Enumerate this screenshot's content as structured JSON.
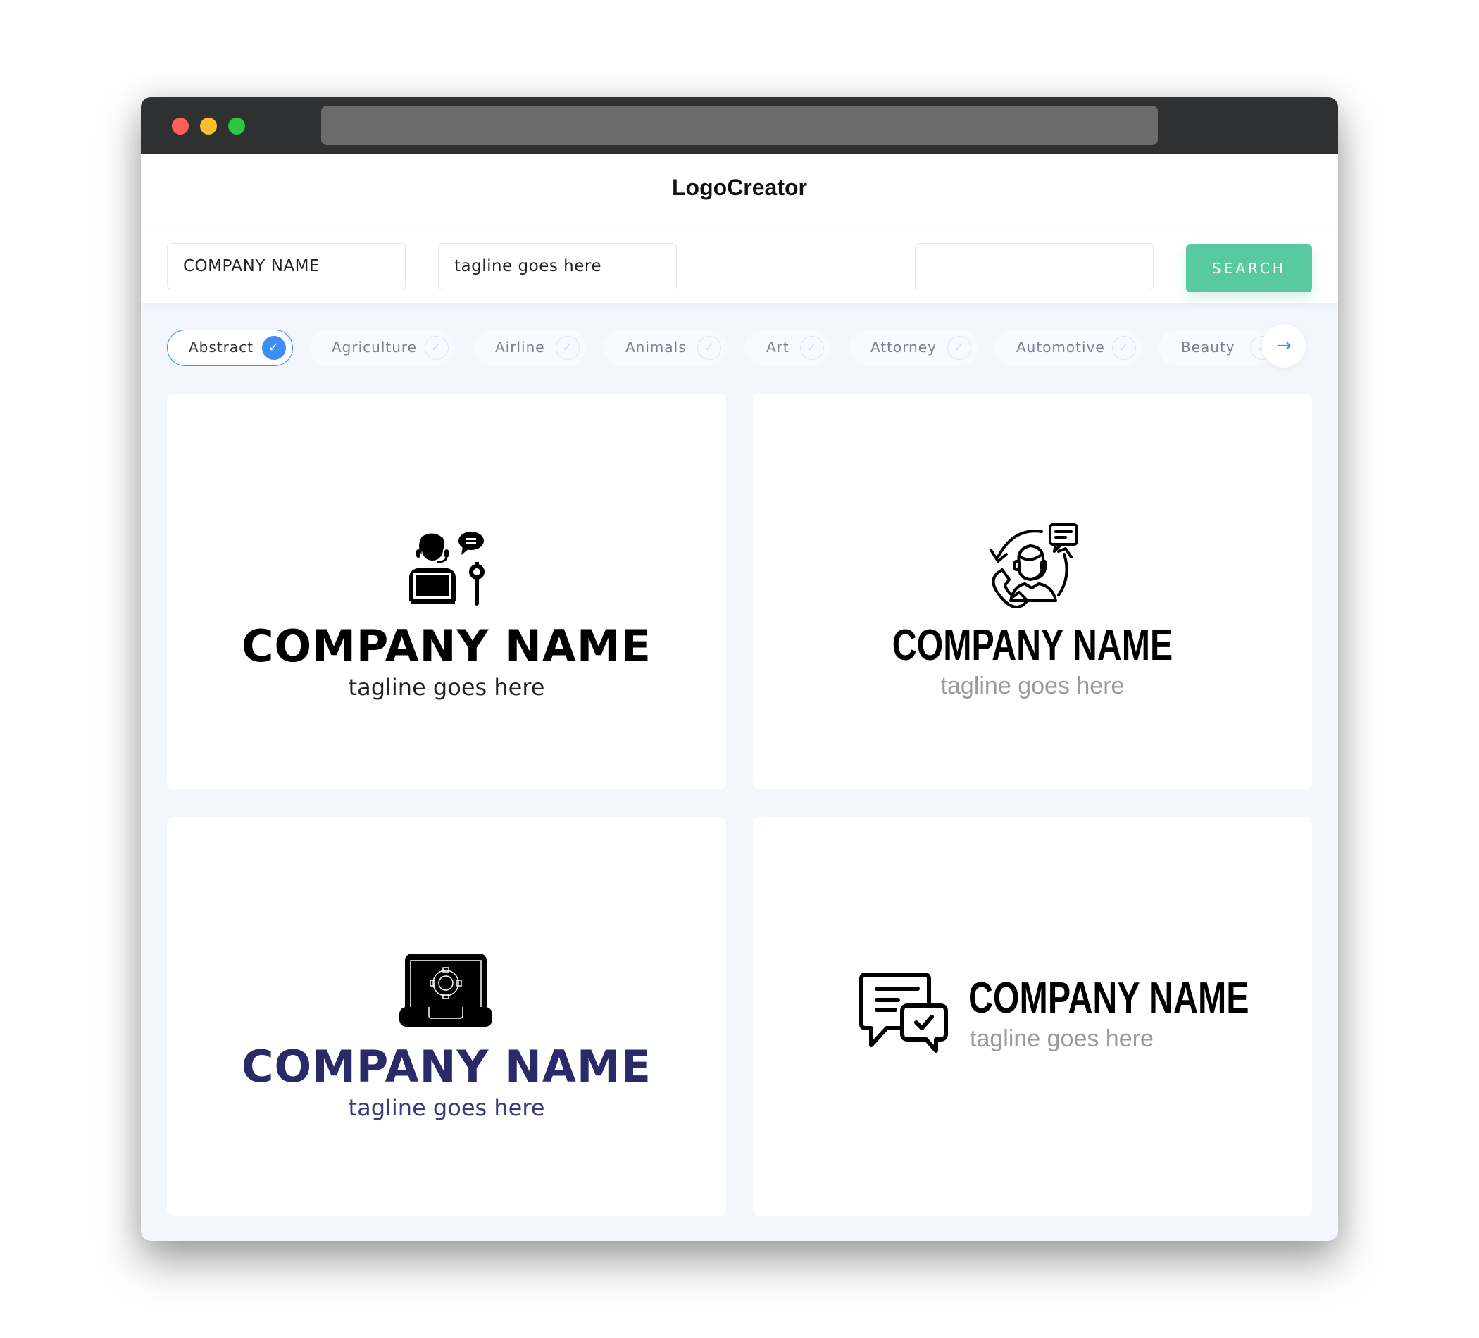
{
  "window": {
    "traffic_lights": [
      "close",
      "minimize",
      "maximize"
    ],
    "url": ""
  },
  "header": {
    "brand": "LogoCreator"
  },
  "toolbar": {
    "company_value": "COMPANY NAME",
    "tagline_value": "tagline goes here",
    "search_value": "",
    "search_label": "SEARCH"
  },
  "categories": {
    "items": [
      {
        "label": "Abstract",
        "selected": true
      },
      {
        "label": "Agriculture",
        "selected": false
      },
      {
        "label": "Airline",
        "selected": false
      },
      {
        "label": "Animals",
        "selected": false
      },
      {
        "label": "Art",
        "selected": false
      },
      {
        "label": "Attorney",
        "selected": false
      },
      {
        "label": "Automotive",
        "selected": false
      },
      {
        "label": "Beauty",
        "selected": false
      }
    ],
    "check_glyph": "✓",
    "next_glyph": "→"
  },
  "logos": [
    {
      "company": "COMPANY NAME",
      "tagline": "tagline goes here",
      "icon": "support-agent-laptop-wrench-icon",
      "name_color": "#000000",
      "tagline_color": "#222222"
    },
    {
      "company": "COMPANY NAME",
      "tagline": "tagline goes here",
      "icon": "customer-service-phone-cycle-icon",
      "name_color": "#000000",
      "tagline_color": "#9a9a9a"
    },
    {
      "company": "COMPANY NAME",
      "tagline": "tagline goes here",
      "icon": "laptop-gear-icon",
      "name_color": "#2a2a68",
      "tagline_color": "#3a3a78"
    },
    {
      "company": "COMPANY NAME",
      "tagline": "tagline goes here",
      "icon": "chat-bubbles-check-icon",
      "name_color": "#000000",
      "tagline_color": "#9a9a9a"
    }
  ],
  "colors": {
    "accent_blue": "#3d8ff6",
    "search_green": "#58c9a0",
    "titlebar": "#2f3032"
  }
}
